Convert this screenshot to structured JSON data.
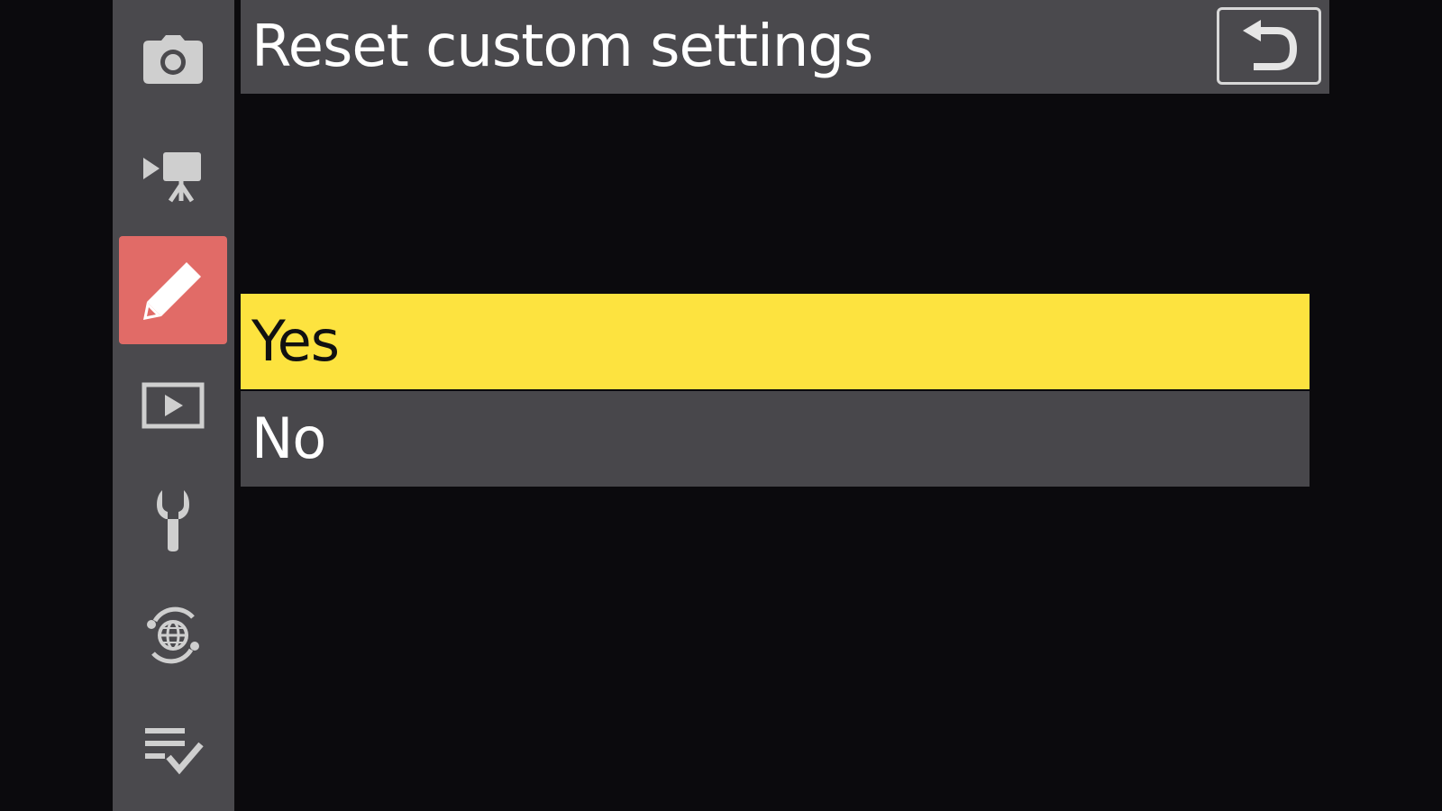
{
  "header": {
    "title": "Reset custom settings"
  },
  "options": [
    {
      "label": "Yes",
      "selected": true
    },
    {
      "label": "No",
      "selected": false
    }
  ],
  "sidebar": {
    "tabs": [
      {
        "icon": "camera-icon",
        "active": false
      },
      {
        "icon": "movie-camera-icon",
        "active": false
      },
      {
        "icon": "pencil-icon",
        "active": true
      },
      {
        "icon": "playback-icon",
        "active": false
      },
      {
        "icon": "wrench-icon",
        "active": false
      },
      {
        "icon": "network-globe-icon",
        "active": false
      },
      {
        "icon": "my-menu-icon",
        "active": false
      }
    ]
  },
  "colors": {
    "background": "#0b0a0d",
    "panel": "#4a494d",
    "highlight": "#fde33f",
    "active_tab": "#e16b67",
    "icon": "#cfcfcf"
  }
}
